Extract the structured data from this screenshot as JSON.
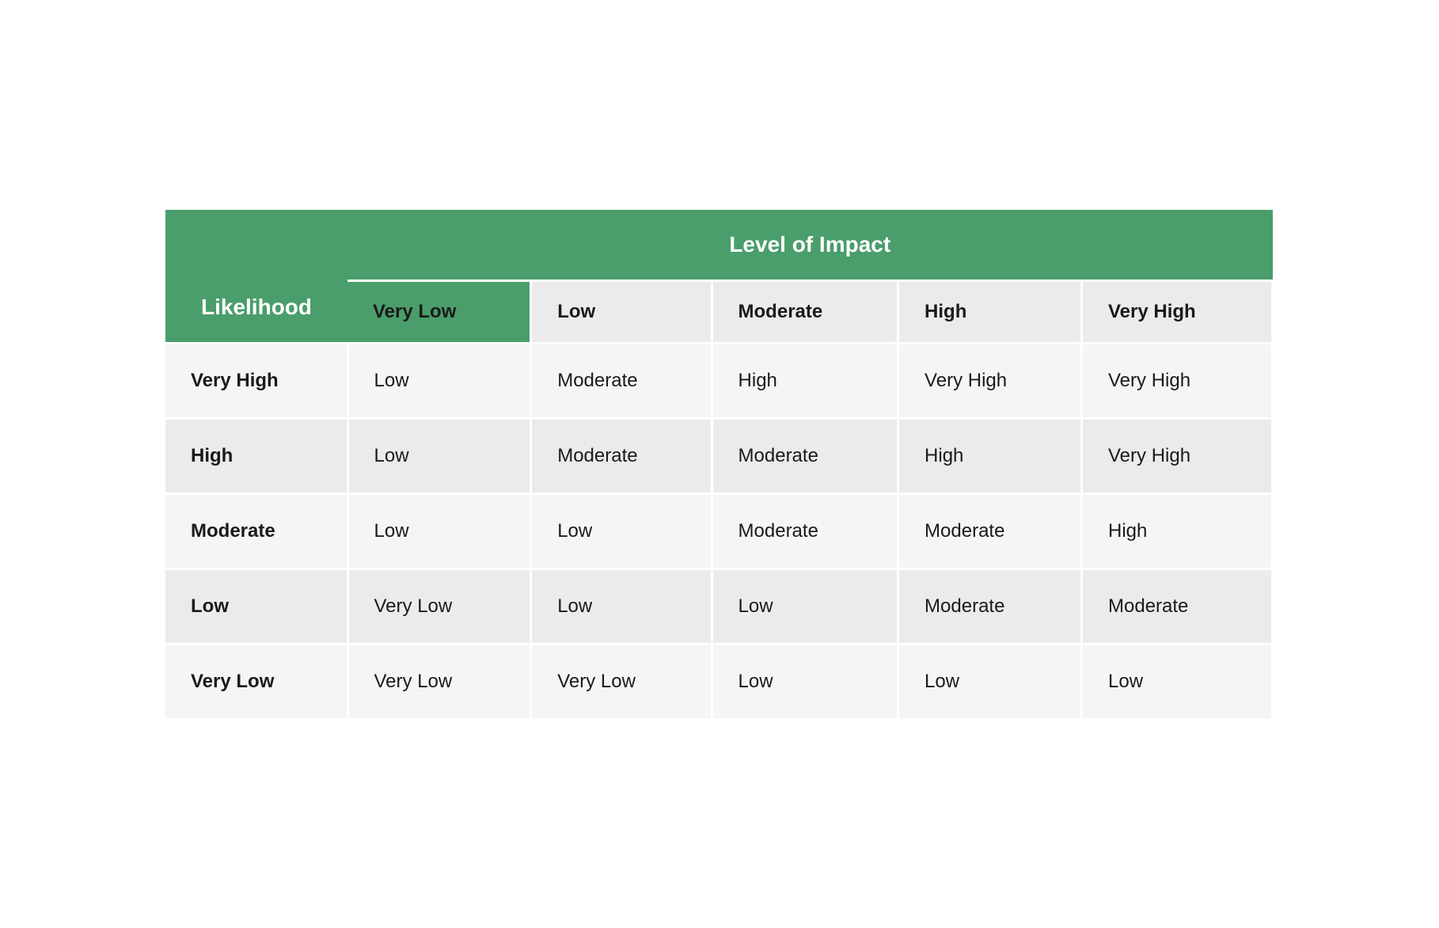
{
  "table": {
    "corner_label": "Likelihood",
    "impact_header": "Level of Impact",
    "col_headers": [
      "Very Low",
      "Low",
      "Moderate",
      "High",
      "Very High"
    ],
    "rows": [
      {
        "likelihood": "Very High",
        "cells": [
          "Low",
          "Moderate",
          "High",
          "Very High",
          "Very High"
        ]
      },
      {
        "likelihood": "High",
        "cells": [
          "Low",
          "Moderate",
          "Moderate",
          "High",
          "Very High"
        ]
      },
      {
        "likelihood": "Moderate",
        "cells": [
          "Low",
          "Low",
          "Moderate",
          "Moderate",
          "High"
        ]
      },
      {
        "likelihood": "Low",
        "cells": [
          "Very Low",
          "Low",
          "Low",
          "Moderate",
          "Moderate"
        ]
      },
      {
        "likelihood": "Very Low",
        "cells": [
          "Very Low",
          "Very Low",
          "Low",
          "Low",
          "Low"
        ]
      }
    ]
  }
}
